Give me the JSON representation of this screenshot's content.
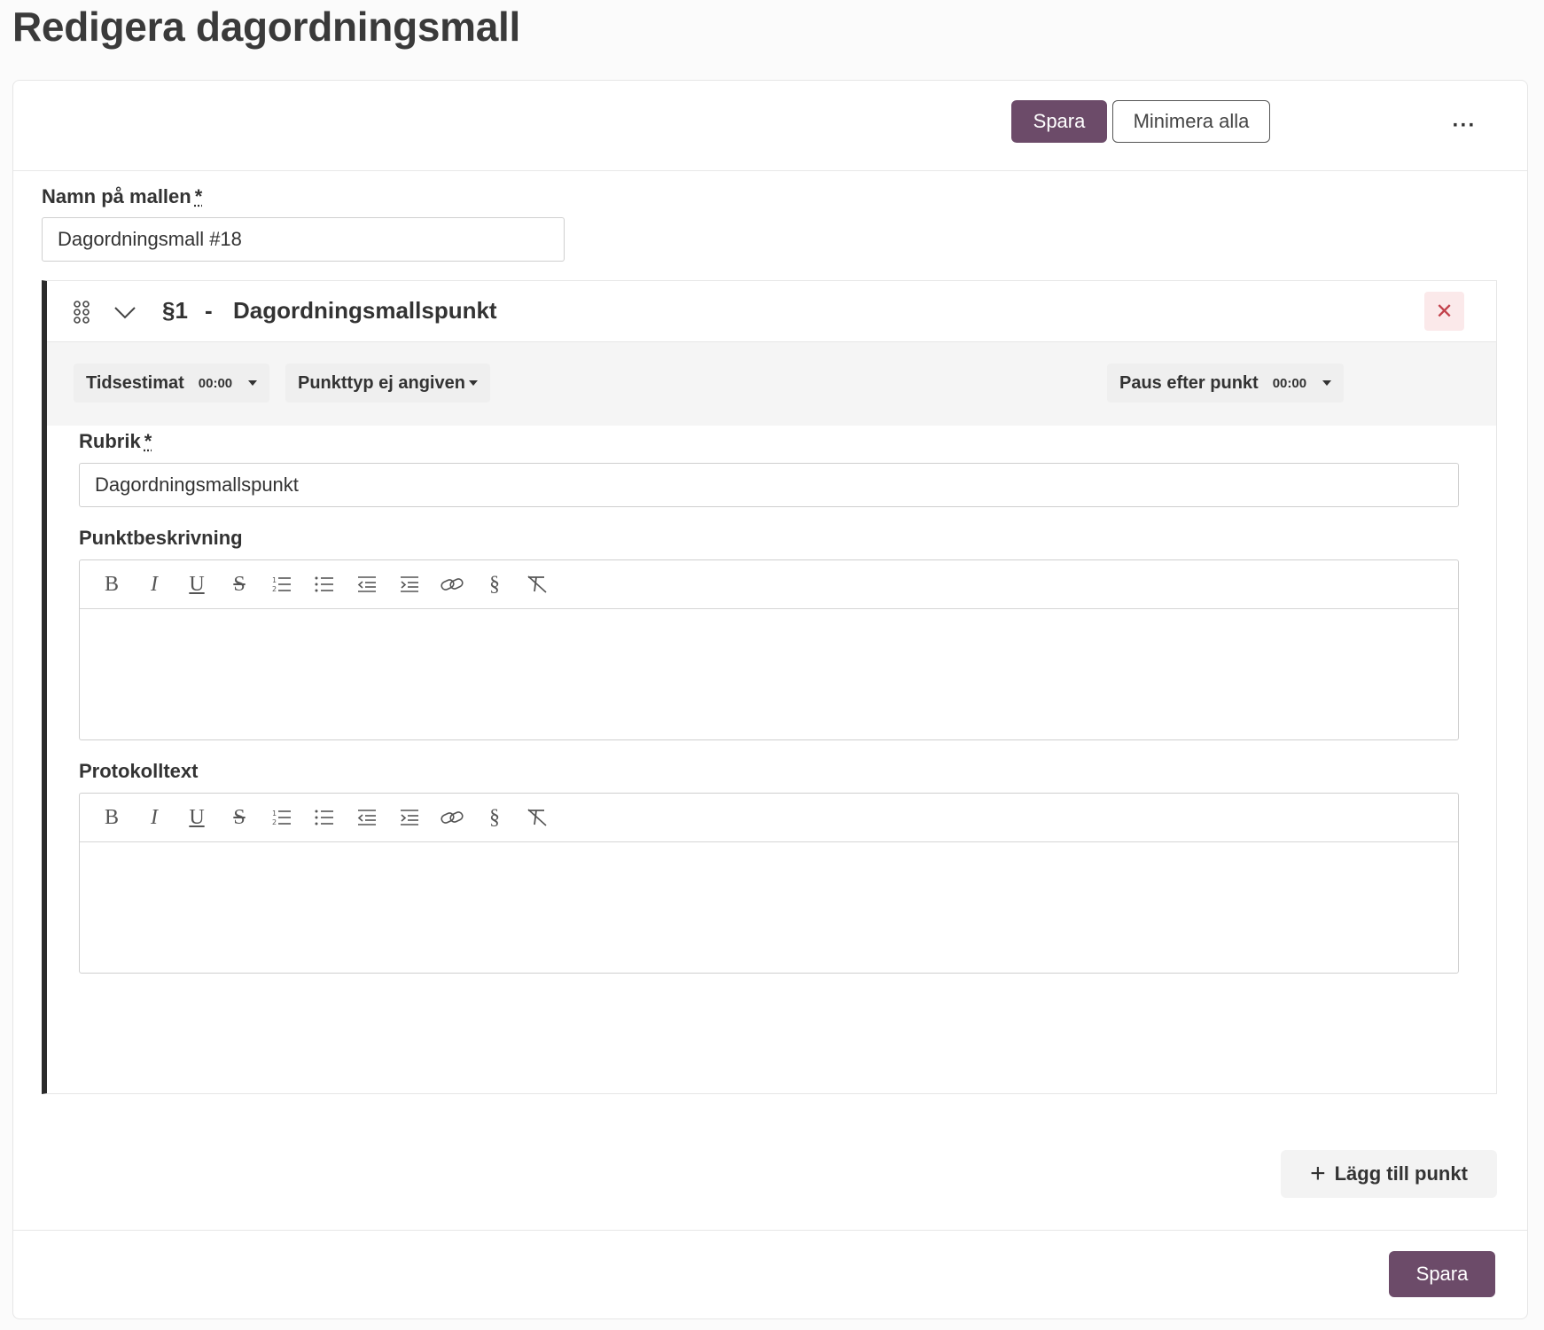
{
  "page": {
    "title": "Redigera dagordningsmall"
  },
  "toolbar": {
    "save_label": "Spara",
    "minimize_label": "Minimera alla",
    "more_label": "···"
  },
  "template_name": {
    "label": "Namn på mallen",
    "required_mark": "*",
    "value": "Dagordningsmall #18"
  },
  "agenda_item": {
    "number": "§1",
    "separator": "-",
    "title": "Dagordningsmallspunkt",
    "close_label": "✕",
    "time_estimate": {
      "label": "Tidsestimat",
      "value": "00:00"
    },
    "point_type": {
      "label": "Punkttyp ej angiven"
    },
    "pause_after": {
      "label": "Paus efter punkt",
      "value": "00:00"
    },
    "heading": {
      "label": "Rubrik",
      "required_mark": "*",
      "value": "Dagordningsmallspunkt"
    },
    "description": {
      "label": "Punktbeskrivning",
      "value": ""
    },
    "protocol": {
      "label": "Protokolltext",
      "value": ""
    }
  },
  "editor_tools": [
    "bold",
    "italic",
    "underline",
    "strikethrough",
    "ordered-list",
    "bullet-list",
    "outdent",
    "indent",
    "link",
    "section",
    "clear-format"
  ],
  "section_glyph": "§",
  "add_point_label": "Lägg till punkt",
  "add_point_icon": "+",
  "footer": {
    "save_label": "Spara"
  },
  "colors": {
    "primary": "#6c4b69",
    "danger": "#c2414b",
    "danger_bg": "#fbe9ea"
  }
}
